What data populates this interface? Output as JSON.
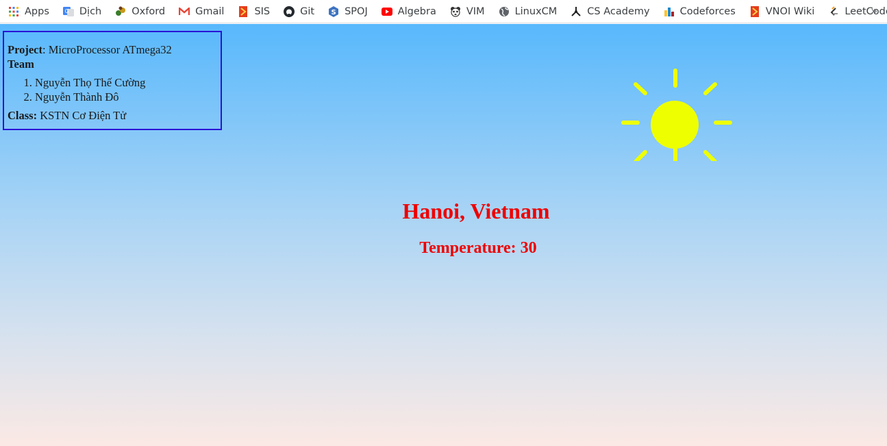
{
  "bookmarks": [
    {
      "label": "Apps",
      "icon": "apps-grid-icon"
    },
    {
      "label": "Dịch",
      "icon": "translate-icon"
    },
    {
      "label": "Oxford",
      "icon": "oxford-icon"
    },
    {
      "label": "Gmail",
      "icon": "gmail-icon"
    },
    {
      "label": "SIS",
      "icon": "sis-icon"
    },
    {
      "label": "Git",
      "icon": "github-icon"
    },
    {
      "label": "SPOJ",
      "icon": "spoj-icon"
    },
    {
      "label": "Algebra",
      "icon": "youtube-icon"
    },
    {
      "label": "VIM",
      "icon": "vim-icon"
    },
    {
      "label": "LinuxCM",
      "icon": "globe-icon"
    },
    {
      "label": "CS Academy",
      "icon": "cs-academy-icon"
    },
    {
      "label": "Codeforces",
      "icon": "codeforces-icon"
    },
    {
      "label": "VNOI Wiki",
      "icon": "vnoi-icon"
    },
    {
      "label": "LeetCode",
      "icon": "leetcode-icon"
    }
  ],
  "more_label": "»",
  "info": {
    "project_label": "Project",
    "project_value": ": MicroProcessor ATmega32",
    "team_label": "Team",
    "members": [
      "Nguyễn Thọ Thế Cường",
      "Nguyễn Thành Đô"
    ],
    "class_label": "Class:",
    "class_value": " KSTN Cơ Điện Tử"
  },
  "weather": {
    "city": "Hanoi, Vietnam",
    "temperature": "Temperature: 30"
  },
  "colors": {
    "sun": "#eeff00",
    "text_red": "#ee0000",
    "box_border": "#2b12d6"
  }
}
